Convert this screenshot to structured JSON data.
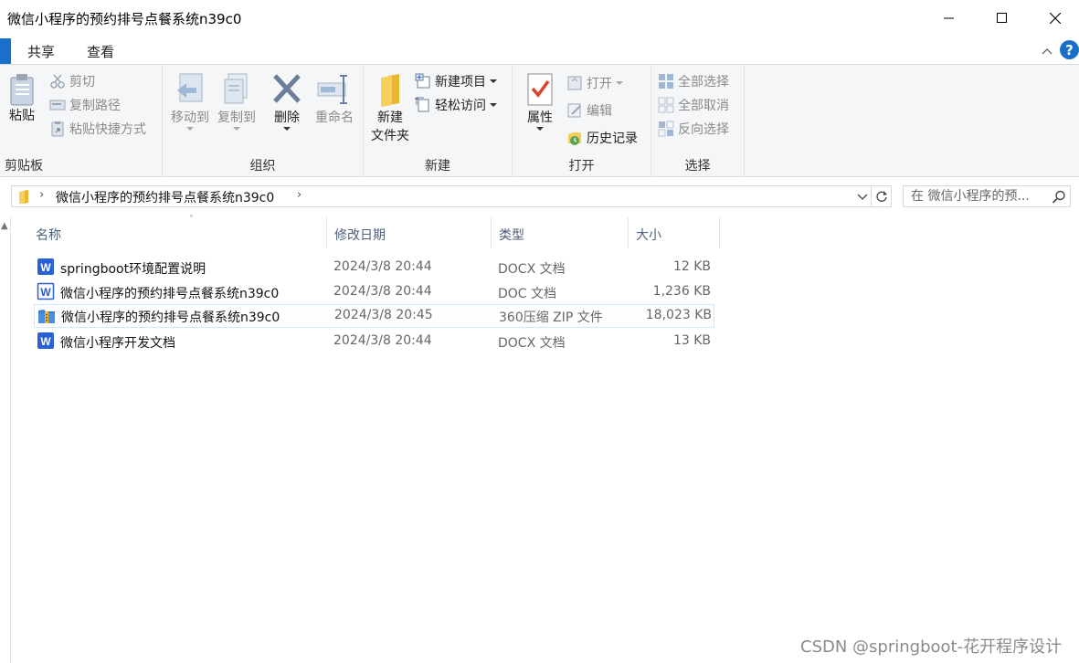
{
  "window": {
    "title": "微信小程序的预约排号点餐系统n39c0"
  },
  "ribbon_tabs": {
    "share": "共享",
    "view": "查看",
    "help": "?"
  },
  "ribbon": {
    "clipboard": {
      "label": "剪贴板",
      "paste": "粘贴",
      "cut": "剪切",
      "copy_path": "复制路径",
      "paste_shortcut": "粘贴快捷方式"
    },
    "organize": {
      "label": "组织",
      "move_to": "移动到",
      "copy_to": "复制到",
      "delete": "删除",
      "rename": "重命名"
    },
    "new": {
      "label": "新建",
      "new_folder_line1": "新建",
      "new_folder_line2": "文件夹",
      "new_item": "新建项目",
      "easy_access": "轻松访问"
    },
    "open": {
      "label": "打开",
      "properties": "属性",
      "open": "打开",
      "edit": "编辑",
      "history": "历史记录"
    },
    "select": {
      "label": "选择",
      "select_all": "全部选择",
      "select_none": "全部取消",
      "invert": "反向选择"
    }
  },
  "address": {
    "path": "微信小程序的预约排号点餐系统n39c0",
    "search_placeholder": "在 微信小程序的预..."
  },
  "columns": {
    "name": "名称",
    "date": "修改日期",
    "type": "类型",
    "size": "大小"
  },
  "files": [
    {
      "name": "springboot环境配置说明",
      "date": "2024/3/8 20:44",
      "type": "DOCX 文档",
      "size": "12 KB",
      "icon": "word-docx-icon",
      "selected": false
    },
    {
      "name": "微信小程序的预约排号点餐系统n39c0",
      "date": "2024/3/8 20:44",
      "type": "DOC 文档",
      "size": "1,236 KB",
      "icon": "word-doc-icon",
      "selected": false
    },
    {
      "name": "微信小程序的预约排号点餐系统n39c0",
      "date": "2024/3/8 20:45",
      "type": "360压缩 ZIP 文件",
      "size": "18,023 KB",
      "icon": "zip-archive-icon",
      "selected": true
    },
    {
      "name": "微信小程序开发文档",
      "date": "2024/3/8 20:44",
      "type": "DOCX 文档",
      "size": "13 KB",
      "icon": "word-docx-icon",
      "selected": false
    }
  ],
  "watermark": "CSDN @springboot-花开程序设计",
  "colors": {
    "accent": "#1a6fc9",
    "ribbon_bg": "#f5f6f7",
    "selection_border": "#cce8ff",
    "column_header_text": "#4c607a",
    "word_blue": "#2b5fd6"
  }
}
